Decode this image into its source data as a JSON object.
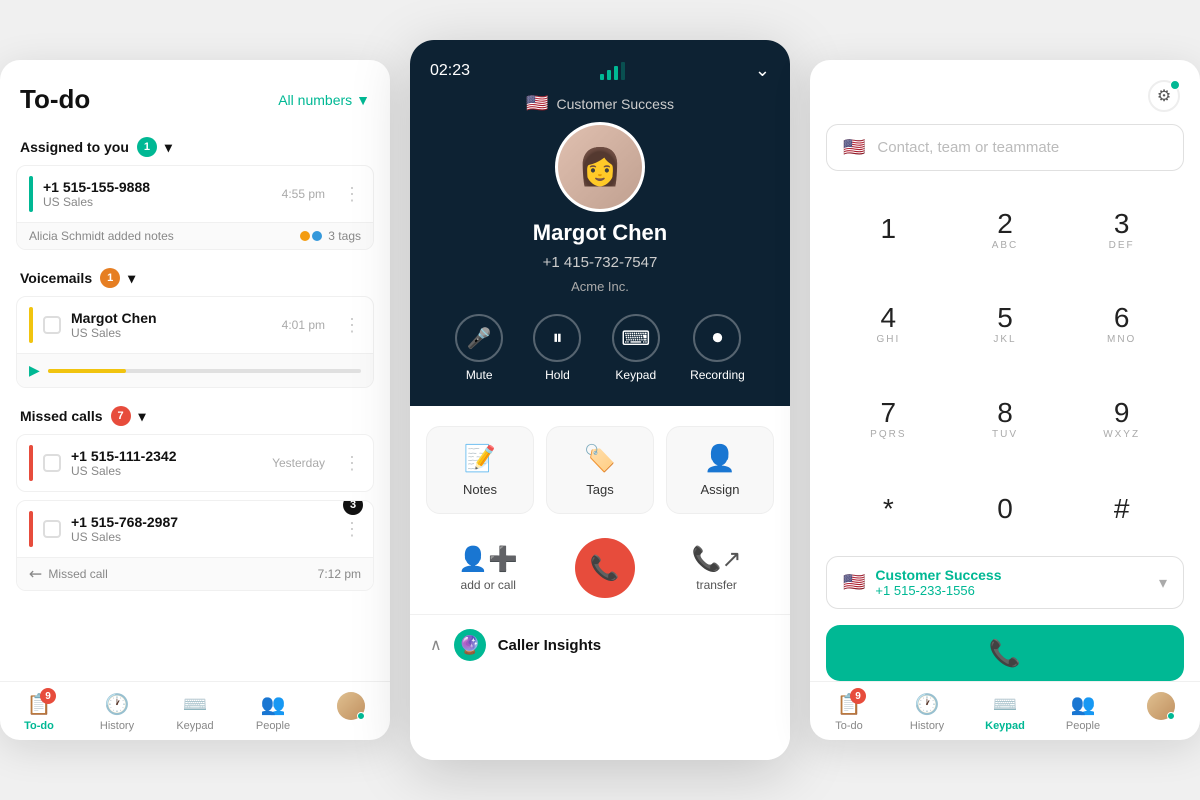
{
  "left_panel": {
    "title": "To-do",
    "filter_label": "All numbers",
    "sections": {
      "assigned": {
        "label": "Assigned to you",
        "count": 1,
        "items": [
          {
            "number": "+1 515-155-9888",
            "sub": "US Sales",
            "time": "4:55 pm",
            "note": "Alicia Schmidt added notes",
            "tags": "3 tags"
          }
        ]
      },
      "voicemails": {
        "label": "Voicemails",
        "count": 1,
        "items": [
          {
            "name": "Margot Chen",
            "sub": "US Sales",
            "time": "4:01 pm"
          }
        ]
      },
      "missed": {
        "label": "Missed calls",
        "count": 7,
        "items": [
          {
            "number": "+1 515-111-2342",
            "sub": "US Sales",
            "time": "Yesterday",
            "badge": 3
          },
          {
            "number": "+1 515-768-2987",
            "sub": "US Sales",
            "time": "7:12 pm",
            "badge": null
          }
        ],
        "missed_label": "Missed call"
      }
    },
    "nav": {
      "items": [
        {
          "label": "To-do",
          "active": true,
          "badge": 9
        },
        {
          "label": "History"
        },
        {
          "label": "Keypad"
        },
        {
          "label": "People"
        },
        {
          "label": "Avatar"
        }
      ]
    }
  },
  "center_panel": {
    "timer": "02:23",
    "team": "Customer Success",
    "caller_name": "Margot Chen",
    "caller_number": "+1 415-732-7547",
    "caller_company": "Acme Inc.",
    "controls": [
      {
        "label": "Mute",
        "icon": "🎤"
      },
      {
        "label": "Hold",
        "icon": "⏸"
      },
      {
        "label": "Keypad",
        "icon": "⌨️"
      },
      {
        "label": "Recording",
        "icon": "⏺"
      }
    ],
    "actions": [
      {
        "label": "Notes",
        "icon": "📝"
      },
      {
        "label": "Tags",
        "icon": "🏷️"
      },
      {
        "label": "Assign",
        "icon": "👤"
      }
    ],
    "secondary_actions": [
      {
        "label": "add or call",
        "icon": "👤"
      },
      {
        "label": "transfer",
        "icon": "📞"
      }
    ],
    "insights_label": "Caller Insights"
  },
  "right_panel": {
    "placeholder": "Contact, team or teammate",
    "keys": [
      {
        "num": "1",
        "alpha": ""
      },
      {
        "num": "2",
        "alpha": "ABC"
      },
      {
        "num": "3",
        "alpha": "DEF"
      },
      {
        "num": "4",
        "alpha": "GHI"
      },
      {
        "num": "5",
        "alpha": "JKL"
      },
      {
        "num": "6",
        "alpha": "MNO"
      },
      {
        "num": "7",
        "alpha": "PQRS"
      },
      {
        "num": "8",
        "alpha": "TUV"
      },
      {
        "num": "9",
        "alpha": "WXYZ"
      },
      {
        "num": "*",
        "alpha": ""
      },
      {
        "num": "0",
        "alpha": ""
      },
      {
        "num": "#",
        "alpha": ""
      }
    ],
    "line_name": "Customer Success",
    "line_number": "+1 515-233-1556",
    "nav": {
      "items": [
        {
          "label": "To-do",
          "badge": 9
        },
        {
          "label": "History"
        },
        {
          "label": "Keypad",
          "active": true
        },
        {
          "label": "People"
        },
        {
          "label": "Avatar"
        }
      ]
    }
  }
}
